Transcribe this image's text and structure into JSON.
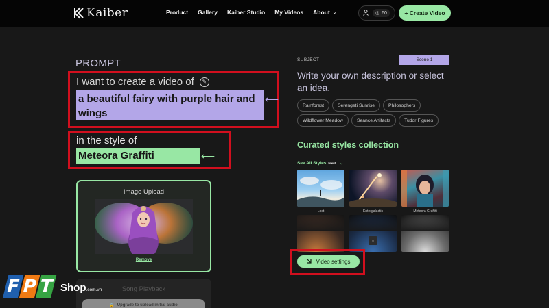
{
  "nav": {
    "brand": "Kaiber",
    "links": [
      "Product",
      "Gallery",
      "Kaiber Studio",
      "My Videos",
      "About"
    ],
    "credits": "60",
    "create_label": "+ Create Video"
  },
  "prompt": {
    "label": "PROMPT",
    "intro": "I want to create a video of",
    "subject": "a beautiful fairy with purple hair and wings",
    "style_intro": "in the style of",
    "style": "Meteora Graffiti"
  },
  "upload": {
    "title": "Image Upload",
    "remove_label": "Remove"
  },
  "song": {
    "title": "Song Playback",
    "button_label": "Upgrade to upload initial audio"
  },
  "subject_panel": {
    "label": "SUBJECT",
    "scene": "Scene 1",
    "instruction": "Write your own description or select an idea.",
    "ideas": [
      "Rainforest",
      "Serengeti Sunrise",
      "Philosophers",
      "Wildflower Meadow",
      "Seance Artifacts",
      "Tudor Figures"
    ]
  },
  "styles": {
    "heading": "Curated styles collection",
    "see_all": "See All Styles",
    "new_badge": "New!",
    "thumbnails": [
      "Lost",
      "Entergalactic",
      "Meteora Graffiti"
    ]
  },
  "video_settings_label": "Video settings",
  "watermark": {
    "letters": [
      "F",
      "P",
      "T"
    ],
    "shop": "Shop",
    "domain": ".com.vn"
  },
  "colors": {
    "accent_green": "#98e7a4",
    "accent_purple": "#b3a6e8",
    "highlight_red": "#d10f1e",
    "background": "#181818"
  }
}
